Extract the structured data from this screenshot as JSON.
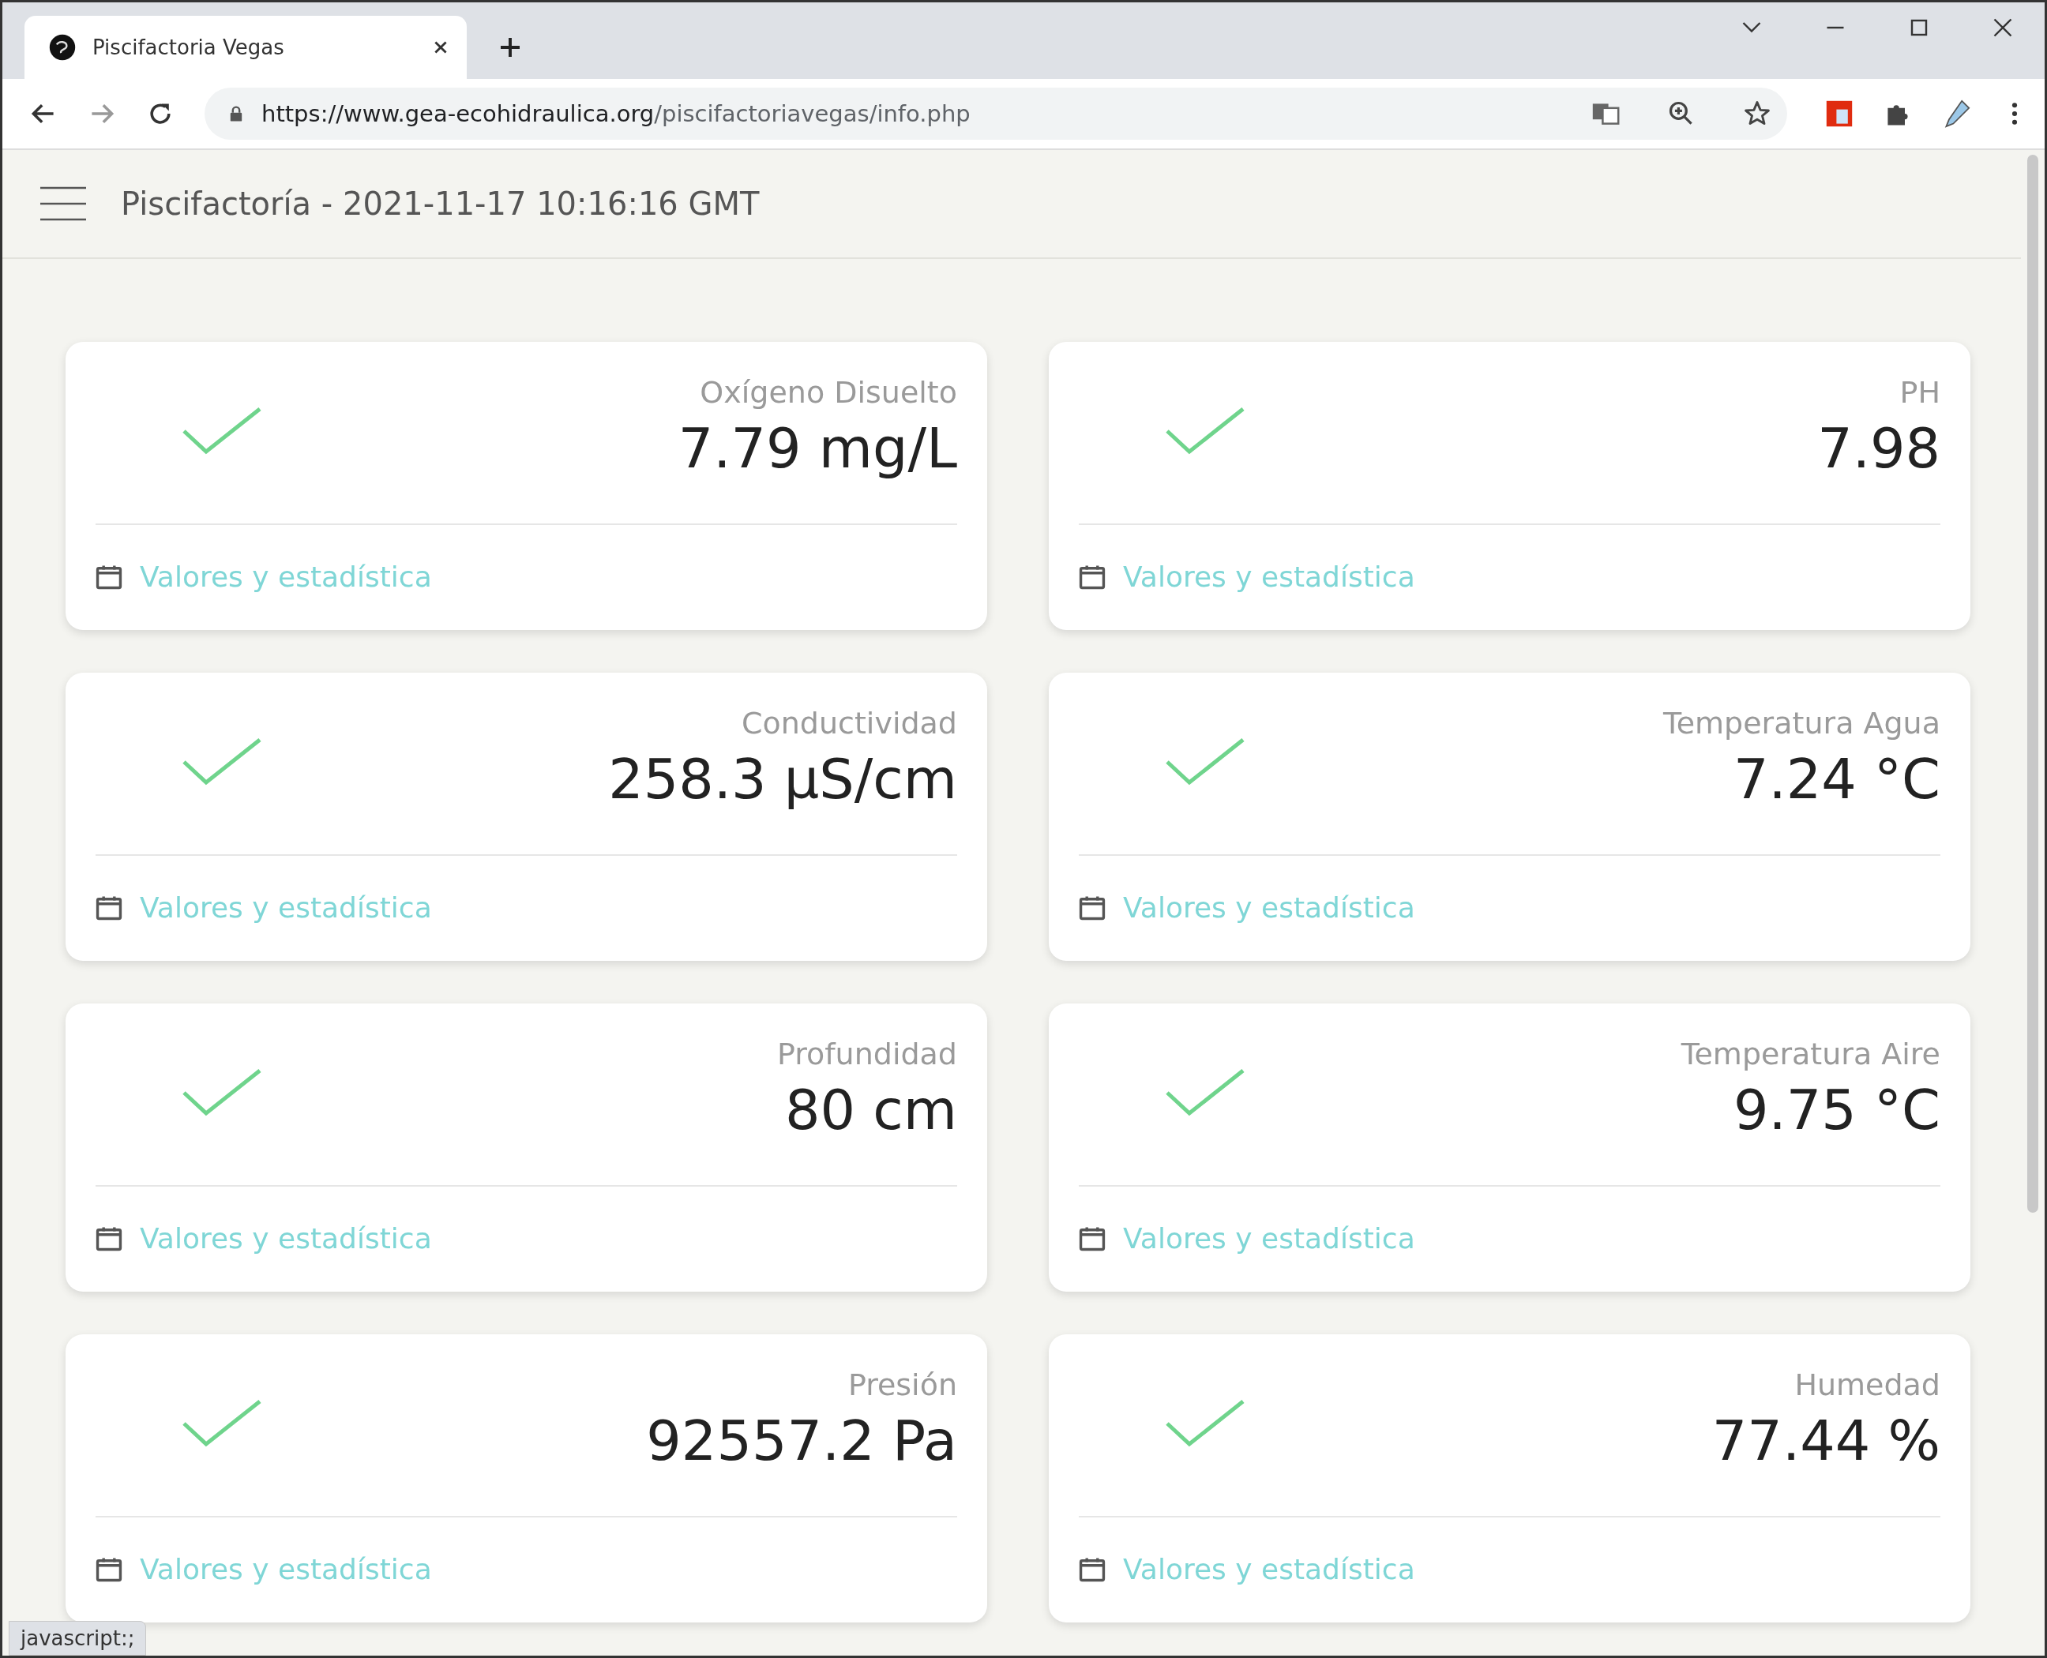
{
  "browser": {
    "tab_title": "Piscifactoria Vegas",
    "url_host": "https://www.gea-ecohidraulica.org",
    "url_path": "/piscifactoriavegas/info.php"
  },
  "header": {
    "title": "Piscifactoría - 2021-11-17 10:16:16 GMT"
  },
  "cards": [
    {
      "label": "Oxígeno Disuelto",
      "value": "7.79 mg/L",
      "ok": true,
      "link": "Valores y estadística"
    },
    {
      "label": "PH",
      "value": "7.98",
      "ok": true,
      "link": "Valores y estadística"
    },
    {
      "label": "Conductividad",
      "value": "258.3 µS/cm",
      "ok": true,
      "link": "Valores y estadística"
    },
    {
      "label": "Temperatura Agua",
      "value": "7.24 °C",
      "ok": true,
      "link": "Valores y estadística"
    },
    {
      "label": "Profundidad",
      "value": "80 cm",
      "ok": true,
      "link": "Valores y estadística"
    },
    {
      "label": "Temperatura Aire",
      "value": "9.75 °C",
      "ok": true,
      "link": "Valores y estadística"
    },
    {
      "label": "Presión",
      "value": "92557.2 Pa",
      "ok": true,
      "link": "Valores y estadística"
    },
    {
      "label": "Humedad",
      "value": "77.44 %",
      "ok": true,
      "link": "Valores y estadística"
    }
  ],
  "status_bar": {
    "text": "javascript:;"
  }
}
